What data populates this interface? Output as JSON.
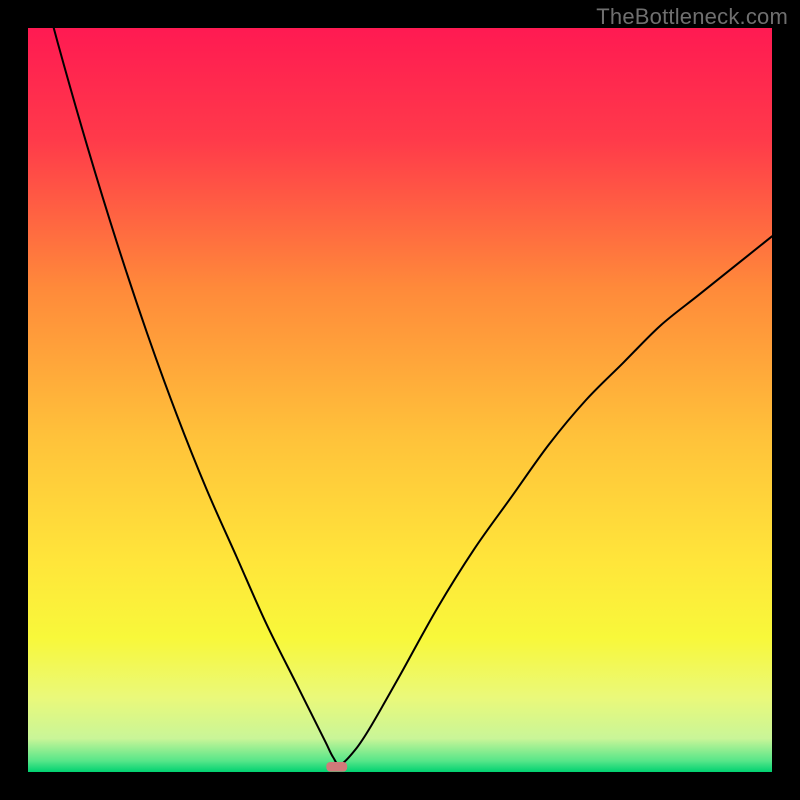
{
  "watermark": "TheBottleneck.com",
  "chart_data": {
    "type": "line",
    "title": "",
    "xlabel": "",
    "ylabel": "",
    "xlim": [
      0,
      100
    ],
    "ylim": [
      0,
      100
    ],
    "grid": false,
    "legend": false,
    "background": {
      "type": "vertical-gradient",
      "stops": [
        {
          "pos": 0.0,
          "color": "#ff1a52"
        },
        {
          "pos": 0.15,
          "color": "#ff3a4a"
        },
        {
          "pos": 0.35,
          "color": "#ff8a3a"
        },
        {
          "pos": 0.55,
          "color": "#ffc23a"
        },
        {
          "pos": 0.72,
          "color": "#ffe63a"
        },
        {
          "pos": 0.82,
          "color": "#f8f83a"
        },
        {
          "pos": 0.9,
          "color": "#eaf97a"
        },
        {
          "pos": 0.955,
          "color": "#c9f598"
        },
        {
          "pos": 0.985,
          "color": "#57e689"
        },
        {
          "pos": 1.0,
          "color": "#00d171"
        }
      ]
    },
    "series": [
      {
        "name": "bottleneck-curve",
        "color": "#000000",
        "stroke_width": 2,
        "x": [
          0,
          4,
          8,
          12,
          16,
          20,
          24,
          28,
          32,
          36,
          38,
          40,
          41,
          42,
          44,
          46,
          50,
          55,
          60,
          65,
          70,
          75,
          80,
          85,
          90,
          95,
          100
        ],
        "y": [
          113,
          98,
          84,
          71,
          59,
          48,
          38,
          29,
          20,
          12,
          8,
          4,
          2,
          1,
          3,
          6,
          13,
          22,
          30,
          37,
          44,
          50,
          55,
          60,
          64,
          68,
          72
        ]
      }
    ],
    "marker": {
      "name": "optimum-marker",
      "shape": "rounded-rect",
      "color": "#d17a7a",
      "cx": 41.5,
      "cy": 0.7,
      "w": 2.8,
      "h": 1.3
    }
  }
}
